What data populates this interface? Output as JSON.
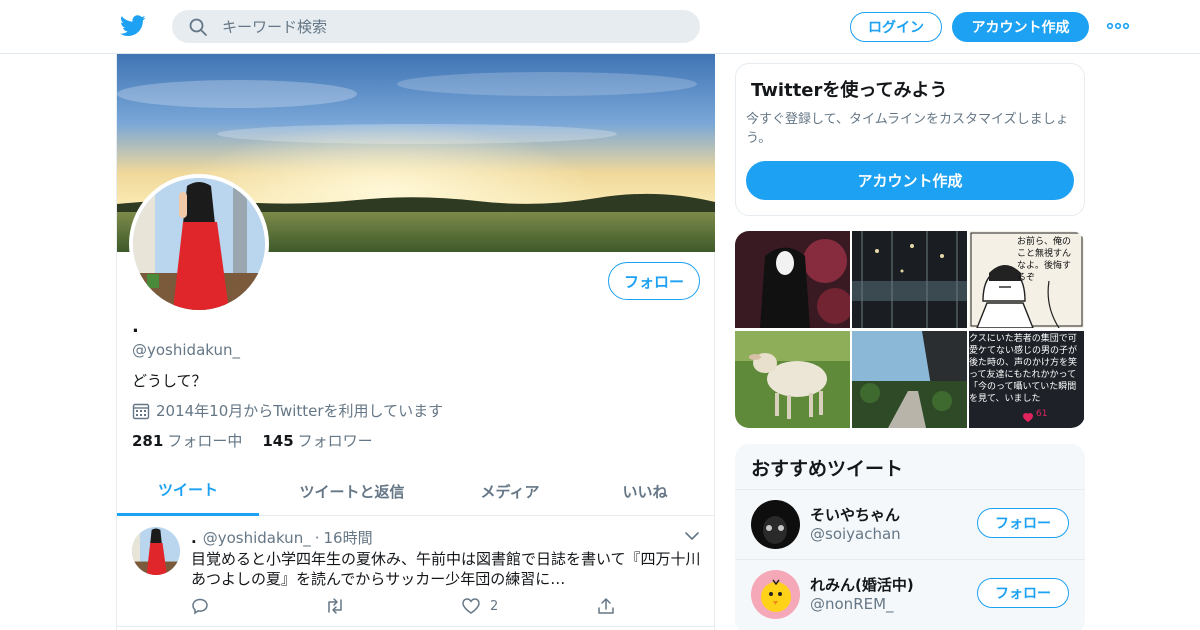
{
  "colors": {
    "accent": "#1da1f2",
    "muted": "#657786",
    "text": "#14171a"
  },
  "header": {
    "logo_icon": "twitter-bird-icon",
    "search_placeholder": "キーワード検索",
    "login_label": "ログイン",
    "signup_label": "アカウント作成",
    "more_icon": "more-dots-icon"
  },
  "profile": {
    "follow_label": "フォロー",
    "name": ".",
    "handle": "@yoshidakun_",
    "bio": "どうして？",
    "joined": "2014年10月からTwitterを利用しています",
    "following_count": "281",
    "following_label": "フォロー中",
    "followers_count": "145",
    "followers_label": "フォロワー"
  },
  "tabs": [
    {
      "label": "ツイート",
      "active": true
    },
    {
      "label": "ツイートと返信",
      "active": false
    },
    {
      "label": "メディア",
      "active": false
    },
    {
      "label": "いいね",
      "active": false
    }
  ],
  "tweet": {
    "name": ".",
    "handle": "@yoshidakun_",
    "separator": "·",
    "time": "16時間",
    "text": "目覚めると小学四年生の夏休み、午前中は図書館で日誌を書いて『四万十川 あつよしの夏』を読んでからサッカー少年団の練習に…",
    "like_count": "2"
  },
  "signup_card": {
    "title": "Twitterを使ってみよう",
    "description": "今すぐ登録して、タイムラインをカスタマイズしましょう。",
    "button_label": "アカウント作成"
  },
  "media_overlay": {
    "speech_text": "お前ら、俺のこと無視すんなよ。後悔するぞ",
    "caption_text": "クスにいた若者の集団で可愛ケてない感じの男の子が後た時の、声のかけ方を笑って友達にもたれかかって「今のって囁いていた瞬間を見て、いました",
    "heart_count": "61"
  },
  "recommend": {
    "title": "おすすめツイート",
    "follow_label": "フォロー",
    "users": [
      {
        "name": "そいやちゃん",
        "handle": "@soiyachan"
      },
      {
        "name": "れみん(婚活中)",
        "handle": "@nonREM_"
      }
    ]
  }
}
